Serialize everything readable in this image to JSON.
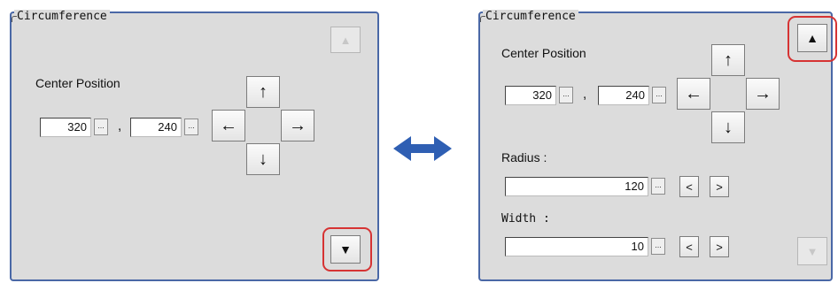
{
  "left": {
    "title": "Circumference",
    "center_label": "Center Position",
    "x_value": "320",
    "y_value": "240",
    "separator": ",",
    "dots": "...",
    "arrows": {
      "up": "↑",
      "left": "←",
      "right": "→",
      "down": "↓"
    },
    "scroll_up": "▲",
    "scroll_down": "▼"
  },
  "transition_arrow": "↔",
  "right": {
    "title": "Circumference",
    "center_label": "Center Position",
    "x_value": "320",
    "y_value": "240",
    "separator": ",",
    "dots": "...",
    "arrows": {
      "up": "↑",
      "left": "←",
      "right": "→",
      "down": "↓"
    },
    "radius_label": "Radius :",
    "radius_value": "120",
    "width_label": "Width :",
    "width_value": "10",
    "decrement": "<",
    "increment": ">",
    "scroll_up": "▲",
    "scroll_down": "▼"
  },
  "colors": {
    "panel_border": "#4a68a6",
    "highlight": "#d63333",
    "transition_arrow": "#2f5fb3"
  }
}
